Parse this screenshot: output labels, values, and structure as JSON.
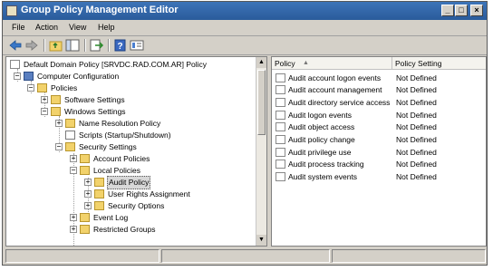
{
  "window": {
    "title": "Group Policy Management Editor"
  },
  "menu": [
    "File",
    "Action",
    "View",
    "Help"
  ],
  "tree": {
    "root": "Default Domain Policy [SRVDC.RAD.COM.AR] Policy",
    "computer_configuration": "Computer Configuration",
    "policies": "Policies",
    "software_settings": "Software Settings",
    "windows_settings": "Windows Settings",
    "name_resolution_policy": "Name Resolution Policy",
    "scripts": "Scripts (Startup/Shutdown)",
    "security_settings": "Security Settings",
    "account_policies": "Account Policies",
    "local_policies": "Local Policies",
    "audit_policy": "Audit Policy",
    "user_rights_assignment": "User Rights Assignment",
    "security_options": "Security Options",
    "event_log": "Event Log",
    "restricted_groups": "Restricted Groups"
  },
  "list": {
    "col_policy": "Policy",
    "col_setting": "Policy Setting",
    "rows": [
      {
        "name": "Audit account logon events",
        "setting": "Not Defined"
      },
      {
        "name": "Audit account management",
        "setting": "Not Defined"
      },
      {
        "name": "Audit directory service access",
        "setting": "Not Defined"
      },
      {
        "name": "Audit logon events",
        "setting": "Not Defined"
      },
      {
        "name": "Audit object access",
        "setting": "Not Defined"
      },
      {
        "name": "Audit policy change",
        "setting": "Not Defined"
      },
      {
        "name": "Audit privilege use",
        "setting": "Not Defined"
      },
      {
        "name": "Audit process tracking",
        "setting": "Not Defined"
      },
      {
        "name": "Audit system events",
        "setting": "Not Defined"
      }
    ]
  },
  "colors": {
    "title_bar": "#2a5b9b",
    "folder": "#f2d26b",
    "selection": "#d8d8d8"
  }
}
